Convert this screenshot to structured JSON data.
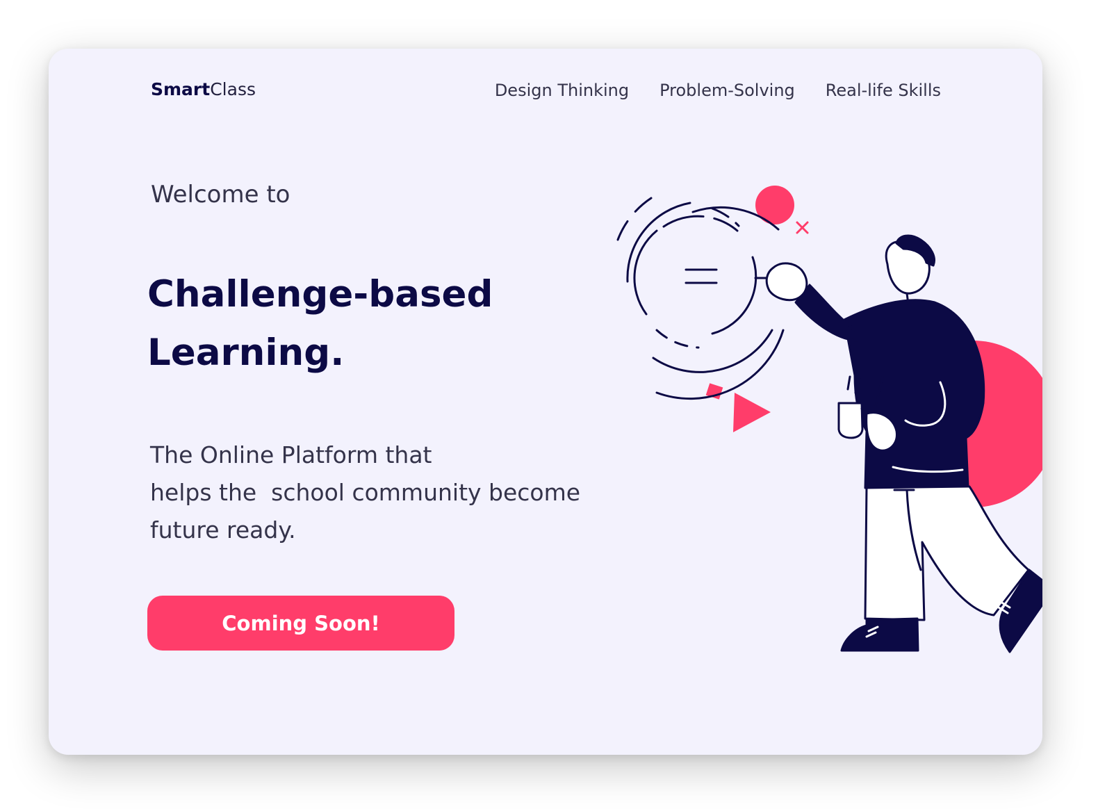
{
  "brand": {
    "bold": "Smart",
    "light": "Class"
  },
  "nav": {
    "items": [
      {
        "label": "Design Thinking"
      },
      {
        "label": "Problem-Solving"
      },
      {
        "label": "Real-life Skills"
      }
    ]
  },
  "hero": {
    "welcome": "Welcome to",
    "headline_line1": "Challenge-based",
    "headline_line2": "Learning.",
    "tagline_line1": "The Online Platform that",
    "tagline_line2": "helps the  school community become",
    "tagline_line3": "future ready.",
    "cta_label": "Coming Soon!"
  },
  "colors": {
    "background": "#f3f2fd",
    "accent": "#ff3d6a",
    "navy": "#0c0a45",
    "text": "#34334a"
  },
  "illustration": {
    "icon": "person-drawing-diagram-illustration"
  }
}
